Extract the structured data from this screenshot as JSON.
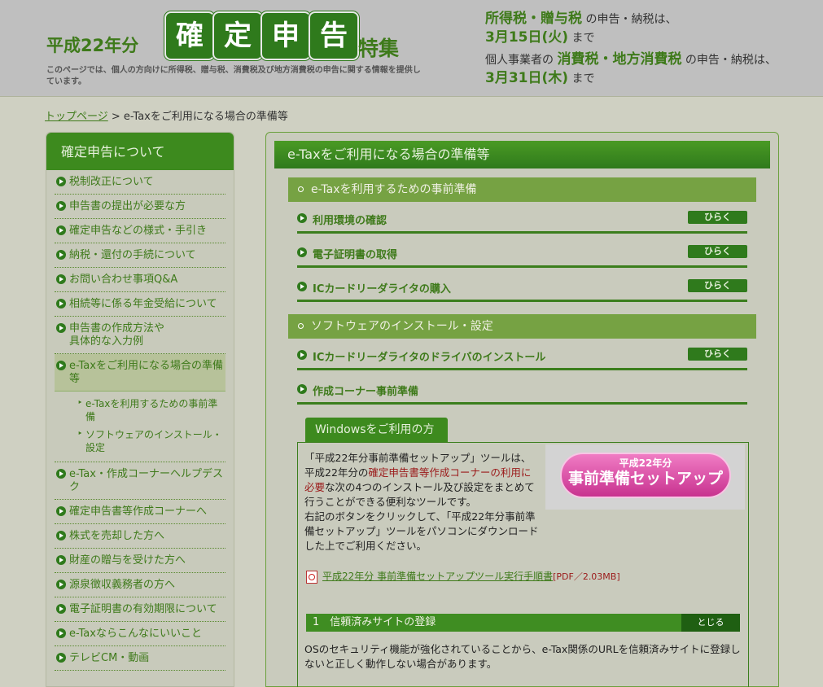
{
  "header": {
    "year_prefix": "平成22年分",
    "title_chars": [
      "確",
      "定",
      "申",
      "告"
    ],
    "title_suffix": "特集",
    "description": "このページでは、個人の方向けに所得税、贈与税、消費税及び地方消費税の申告に関する情報を提供しています。",
    "right1_em": "所得税・贈与税",
    "right1_text": " の申告・納税は、",
    "right1_date": "3月15日(火)",
    "right1_tail": " まで",
    "right2_pre": "個人事業者の ",
    "right2_em": "消費税・地方消費税",
    "right2_text": " の申告・納税は、",
    "right2_date": "3月31日(木)",
    "right2_tail": " まで"
  },
  "breadcrumb": {
    "home": "トップページ",
    "sep": " > ",
    "current": "e-Taxをご利用になる場合の準備等"
  },
  "sidebar": {
    "heading": "確定申告について",
    "items": [
      "税制改正について",
      "申告書の提出が必要な方",
      "確定申告などの様式・手引き",
      "納税・還付の手続について",
      "お問い合わせ事項Q&A",
      "相続等に係る年金受給について",
      "申告書の作成方法や\n具体的な入力例",
      "e-Taxをご利用になる場合の準備等"
    ],
    "sub_items": [
      "e-Taxを利用するための事前準備",
      "ソフトウェアのインストール・設定"
    ],
    "items_after": [
      "e-Tax・作成コーナーヘルプデスク",
      "確定申告書等作成コーナーへ",
      "株式を売却した方へ",
      "財産の贈与を受けた方へ",
      "源泉徴収義務者の方へ",
      "電子証明書の有効期限について",
      "e-Taxならこんなにいいこと",
      "テレビCM・動画"
    ]
  },
  "main": {
    "title": "e-Taxをご利用になる場合の準備等",
    "section1": "e-Taxを利用するための事前準備",
    "section1_rows": [
      "利用環境の確認",
      "電子証明書の取得",
      "ICカードリーダライタの購入"
    ],
    "section2": "ソフトウェアのインストール・設定",
    "section2_rows": [
      "ICカードリーダライタのドライバのインストール",
      "作成コーナー事前準備"
    ],
    "open_label": "ひらく",
    "windows_tab": "Windowsをご利用の方",
    "win_text_1": "「平成22年分事前準備セットアップ」ツールは、平成22年分の",
    "win_text_red": "確定申告書等作成コーナーの利用に必要",
    "win_text_2": "な次の4つのインストール及び設定をまとめて行うことができる便利なツールです。",
    "win_text_3": "右記のボタンをクリックして、「平成22年分事前準備セットアップ」ツールをパソコンにダウンロードした上でご利用ください。",
    "setup_small": "平成22年分",
    "setup_big": "事前準備セットアップ",
    "pdf_link": "平成22年分 事前準備セットアップツール実行手順書",
    "pdf_meta": "[PDF／2.03MB]",
    "step_title": "1　信頼済みサイトの登録",
    "close_label": "とじる",
    "step_text": "OSのセキュリティ機能が強化されていることから、e-Tax関係のURLを信頼済みサイトに登録しないと正しく動作しない場合があります。"
  }
}
